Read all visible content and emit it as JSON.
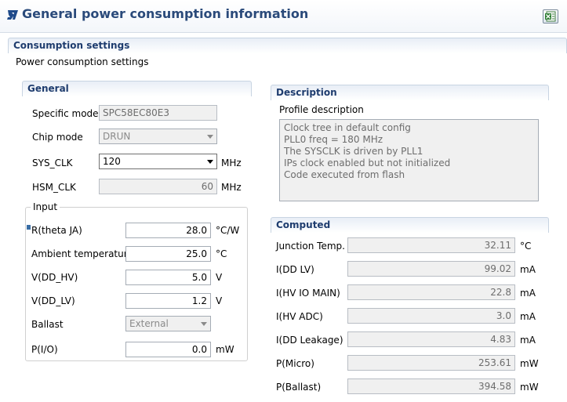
{
  "header": {
    "title": "General power consumption information",
    "logo_icon": "st-logo-icon",
    "export_icon": "excel-export-icon"
  },
  "consumption": {
    "section_title": "Consumption settings",
    "subtitle": "Power consumption settings"
  },
  "general": {
    "section_title": "General",
    "specific_model": {
      "label": "Specific model",
      "value": "SPC58EC80E3"
    },
    "chip_mode": {
      "label": "Chip mode",
      "value": "DRUN"
    },
    "sys_clk": {
      "label": "SYS_CLK",
      "value": "120",
      "unit": "MHz"
    },
    "hsm_clk": {
      "label": "HSM_CLK",
      "value": "60",
      "unit": "MHz"
    }
  },
  "input": {
    "group_title": "Input",
    "r_theta": {
      "label": "R(theta JA)",
      "value": "28.0",
      "unit": "°C/W"
    },
    "ambient": {
      "label": "Ambient temperature",
      "value": "25.0",
      "unit": "°C"
    },
    "vdd_hv": {
      "label": "V(DD_HV)",
      "value": "5.0",
      "unit": "V"
    },
    "vdd_lv": {
      "label": "V(DD_LV)",
      "value": "1.2",
      "unit": "V"
    },
    "ballast": {
      "label": "Ballast",
      "value": "External"
    },
    "p_io": {
      "label": "P(I/O)",
      "value": "0.0",
      "unit": "mW"
    }
  },
  "description": {
    "section_title": "Description",
    "profile_label": "Profile description",
    "lines": [
      "Clock tree in default config",
      "PLL0 freq = 180 MHz",
      "The SYSCLK is driven by PLL1",
      "IPs clock enabled but not initialized",
      "Code executed from flash"
    ]
  },
  "computed": {
    "section_title": "Computed",
    "rows": [
      {
        "label": "Junction Temp.",
        "value": "32.11",
        "unit": "°C"
      },
      {
        "label": "I(DD LV)",
        "value": "99.02",
        "unit": "mA"
      },
      {
        "label": "I(HV IO MAIN)",
        "value": "22.8",
        "unit": "mA"
      },
      {
        "label": "I(HV ADC)",
        "value": "3.0",
        "unit": "mA"
      },
      {
        "label": "I(DD Leakage)",
        "value": "4.83",
        "unit": "mA"
      },
      {
        "label": "P(Micro)",
        "value": "253.61",
        "unit": "mW"
      },
      {
        "label": "P(Ballast)",
        "value": "394.58",
        "unit": "mW"
      }
    ]
  },
  "colors": {
    "title": "#2a4a7a",
    "section_title": "#1e3c6e",
    "readonly_bg": "#f0f0f0"
  }
}
